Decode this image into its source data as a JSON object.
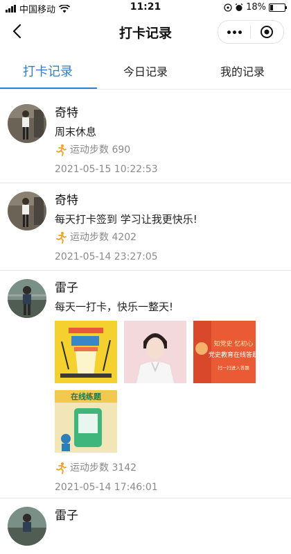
{
  "status_bar": {
    "carrier": "中国移动",
    "time": "11:21",
    "battery": "18%",
    "battery_level": 0.18
  },
  "nav": {
    "title": "打卡记录"
  },
  "tabs": [
    {
      "label": "打卡记录",
      "active": true
    },
    {
      "label": "今日记录",
      "active": false
    },
    {
      "label": "我的记录",
      "active": false
    }
  ],
  "posts": [
    {
      "name": "奇特",
      "content": "周末休息",
      "steps": "运动步数 690",
      "time": "2021-05-15 10:22:53"
    },
    {
      "name": "奇特",
      "content": "每天打卡签到 学习让我更快乐!",
      "steps": "运动步数 4202",
      "time": "2021-05-14 23:27:05"
    },
    {
      "name": "雷子",
      "content": "每天一打卡，快乐一整天!",
      "steps": "运动步数 3142",
      "time": "2021-05-14 17:46:01",
      "images": [
        {
          "kind": "illustration"
        },
        {
          "kind": "portrait"
        },
        {
          "kind": "poster",
          "line1": "知党史 忆初心",
          "line2": "党史教育在线答题",
          "line3": "扫一扫进入答题"
        },
        {
          "kind": "poster-green",
          "line1": "在线练题"
        }
      ]
    },
    {
      "name": "雷子"
    }
  ],
  "colors": {
    "accent": "#2d80c9",
    "runner_icon": "#f0a020"
  }
}
